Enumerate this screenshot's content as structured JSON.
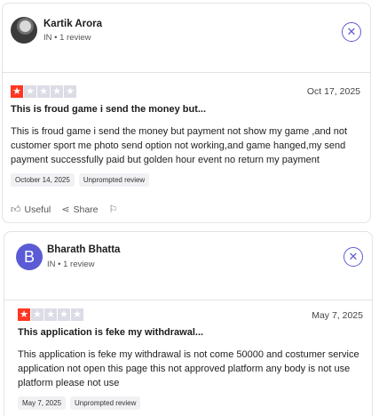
{
  "reviews": [
    {
      "user": {
        "name": "Kartik Arora",
        "meta": "IN • 1 review",
        "avatar": "photo"
      },
      "rating": 1,
      "date": "Oct 17, 2025",
      "title": "This is froud game i send the money but...",
      "body": "This is froud game i send the money but payment not show my game ,and not customer sport me photo send option not working,and game hanged,my send payment successfully paid but golden hour event no return my payment",
      "experience_date": "October 14, 2025",
      "badge": "Unprompted review",
      "actions": {
        "useful": "Useful",
        "share": "Share"
      }
    },
    {
      "user": {
        "name": "Bharath Bhatta",
        "meta": "IN • 1 review",
        "avatar_letter": "B"
      },
      "rating": 1,
      "date": "May 7, 2025",
      "title": "This application is feke my withdrawal...",
      "body": "This application is feke my withdrawal is not come 50000 and costumer service application not open this page this not approved platform any body is not use platform please not use",
      "experience_date": "May 7, 2025",
      "badge": "Unprompted review"
    }
  ],
  "icons": {
    "close": "close-icon",
    "star": "star-icon",
    "thumb": "thumbs-up-icon",
    "share": "share-icon",
    "flag": "flag-icon"
  },
  "colors": {
    "star_on": "#ff3722",
    "star_off": "#dcdce6",
    "accent": "#5b5bd6"
  }
}
